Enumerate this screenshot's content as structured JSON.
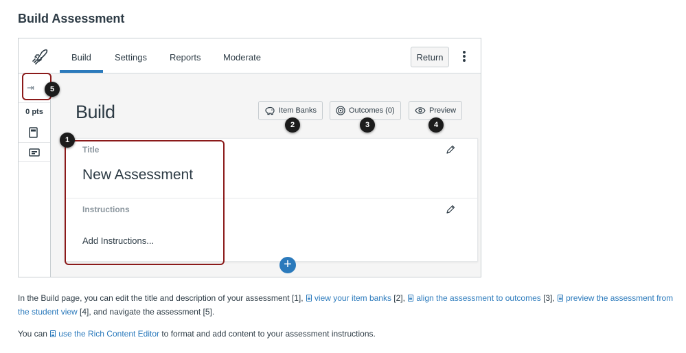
{
  "page": {
    "heading": "Build Assessment"
  },
  "app": {
    "tabs": [
      {
        "label": "Build",
        "active": true
      },
      {
        "label": "Settings"
      },
      {
        "label": "Reports"
      },
      {
        "label": "Moderate"
      }
    ],
    "return_label": "Return",
    "rail": {
      "points": "0 pts",
      "icons": [
        "collapse-icon",
        "calculator-icon",
        "card-icon"
      ]
    },
    "build_title": "Build",
    "buttons": {
      "item_banks": "Item Banks",
      "outcomes": "Outcomes (0)",
      "preview": "Preview"
    },
    "title_label": "Title",
    "title_value": "New Assessment",
    "instructions_label": "Instructions",
    "instructions_value": "Add Instructions...",
    "accent_color": "#2b7abc"
  },
  "callouts": [
    "1",
    "2",
    "3",
    "4",
    "5"
  ],
  "description": {
    "p1": {
      "t1": "In the Build page, you can edit the title and description of your assessment [1], ",
      "link1": "view your item banks",
      "t2": " [2], ",
      "link2": "align the assessment to outcomes",
      "t3": " [3], ",
      "link3": "preview the assessment from the student view",
      "t4": " [4], and navigate the assessment [5]."
    },
    "p2": {
      "t1": "You can ",
      "link1": "use the Rich Content Editor",
      "t2": " to format and add content to your assessment instructions."
    }
  }
}
